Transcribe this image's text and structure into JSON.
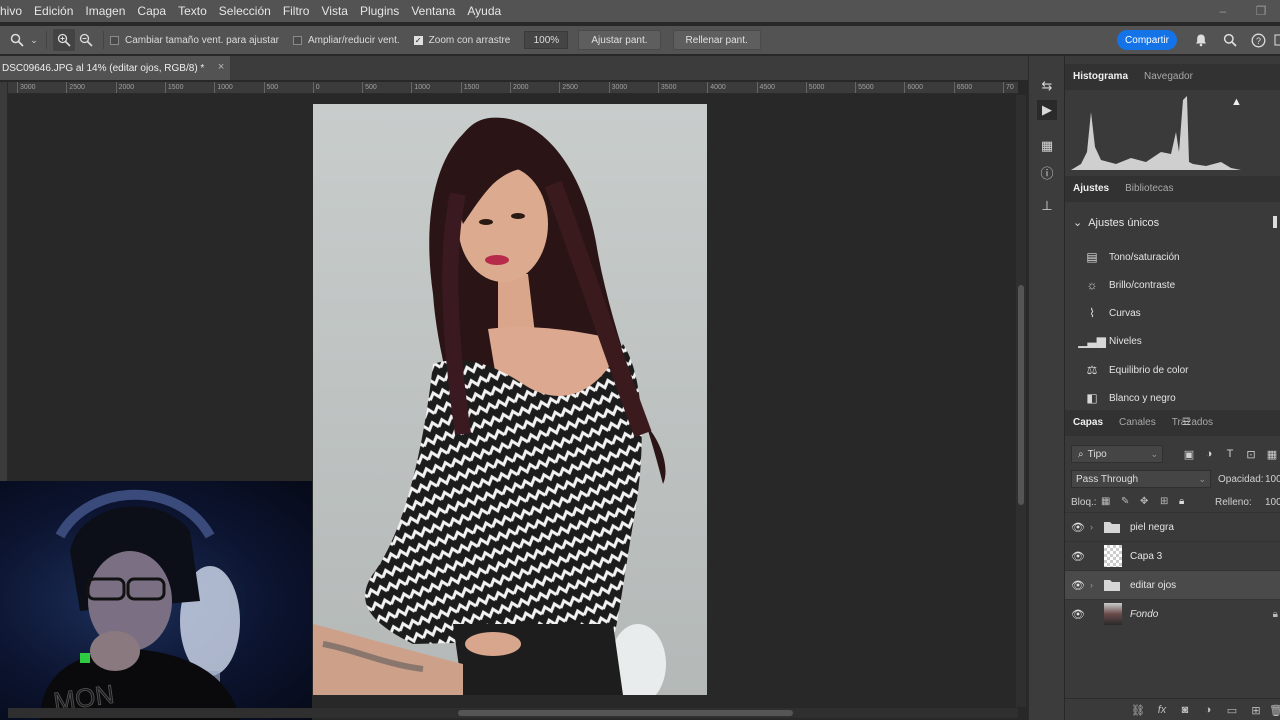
{
  "menu": [
    "chivo",
    "Edición",
    "Imagen",
    "Capa",
    "Texto",
    "Selección",
    "Filtro",
    "Vista",
    "Plugins",
    "Ventana",
    "Ayuda"
  ],
  "options": {
    "resize_windows_label": "Cambiar tamaño vent. para ajustar",
    "zoom_all_label": "Ampliar/reducir vent.",
    "scrubby_zoom_label": "Zoom con arrastre",
    "scrubby_zoom_checked": true,
    "zoom_value": "100%",
    "fit_screen_label": "Ajustar pant.",
    "fill_screen_label": "Rellenar pant."
  },
  "share_label": "Compartir",
  "document": {
    "tab_title": "DSC09646.JPG al 14% (editar ojos, RGB/8) *",
    "close_glyph": "×"
  },
  "ruler_ticks": [
    "3000",
    "2500",
    "2000",
    "1500",
    "1000",
    "500",
    "0",
    "500",
    "1000",
    "1500",
    "2000",
    "2500",
    "3000",
    "3500",
    "4000",
    "4500",
    "5000",
    "5500",
    "6000",
    "6500",
    "70"
  ],
  "panels": {
    "histogram_tab": "Histograma",
    "navigator_tab": "Navegador",
    "adjustments_tab": "Ajustes",
    "libraries_tab": "Bibliotecas",
    "adjustments_section": "Ajustes únicos",
    "adjustments": [
      {
        "label": "Tono/saturación",
        "icon": "hue-saturation-icon"
      },
      {
        "label": "Brillo/contraste",
        "icon": "brightness-contrast-icon"
      },
      {
        "label": "Curvas",
        "icon": "curves-icon"
      },
      {
        "label": "Niveles",
        "icon": "levels-icon"
      },
      {
        "label": "Equilibrio de color",
        "icon": "color-balance-icon"
      },
      {
        "label": "Blanco y negro",
        "icon": "black-white-icon"
      }
    ],
    "layers_tab": "Capas",
    "channels_tab": "Canales",
    "paths_tab": "Trazados",
    "kind_filter": "Tipo",
    "blend_mode": "Pass Through",
    "opacity_label": "Opacidad:",
    "opacity_value": "100",
    "lock_label": "Bloq.:",
    "fill_label": "Relleno:",
    "fill_value": "100",
    "layers": [
      {
        "name": "piel negra",
        "type": "group",
        "visible": true,
        "selected": false
      },
      {
        "name": "Capa 3",
        "type": "pixel",
        "visible": true,
        "selected": false
      },
      {
        "name": "editar ojos",
        "type": "group",
        "visible": true,
        "selected": true
      },
      {
        "name": "Fondo",
        "type": "background",
        "visible": true,
        "selected": false
      }
    ]
  }
}
